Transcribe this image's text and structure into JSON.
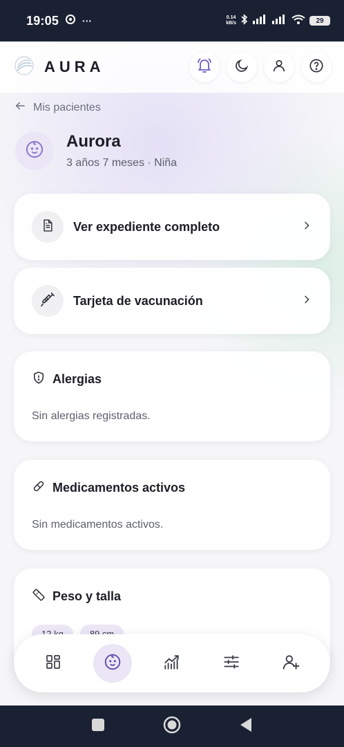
{
  "status_bar": {
    "time": "19:05",
    "more": "···",
    "net_speed_value": "0.14",
    "net_speed_unit": "kB/s",
    "battery": "29"
  },
  "app": {
    "brand_name": "AURA",
    "back_label": "Mis pacientes",
    "patient": {
      "name": "Aurora",
      "info": "3 años 7 meses · Niña"
    },
    "links": [
      {
        "label": "Ver expediente completo",
        "icon": "document-icon"
      },
      {
        "label": "Tarjeta de vacunación",
        "icon": "syringe-icon"
      }
    ],
    "allergies": {
      "title": "Alergias",
      "empty": "Sin alergias registradas."
    },
    "medications": {
      "title": "Medicamentos activos",
      "empty": "Sin medicamentos activos."
    },
    "growth": {
      "title": "Peso y talla",
      "chips": [
        "12 kg",
        "89 cm"
      ]
    }
  },
  "bottom_nav": [
    {
      "name": "dashboard",
      "icon": "grid-icon",
      "active": false
    },
    {
      "name": "patients",
      "icon": "baby-face-icon",
      "active": true
    },
    {
      "name": "growth",
      "icon": "chart-icon",
      "active": false
    },
    {
      "name": "settings",
      "icon": "sliders-icon",
      "active": false
    },
    {
      "name": "add-patient",
      "icon": "user-plus-icon",
      "active": false
    }
  ],
  "colors": {
    "accent": "#6f5bbf",
    "accent_soft": "#ebe6f6",
    "status_bar": "#1a2133",
    "text": "#1d1d26",
    "muted": "#5d606c"
  }
}
